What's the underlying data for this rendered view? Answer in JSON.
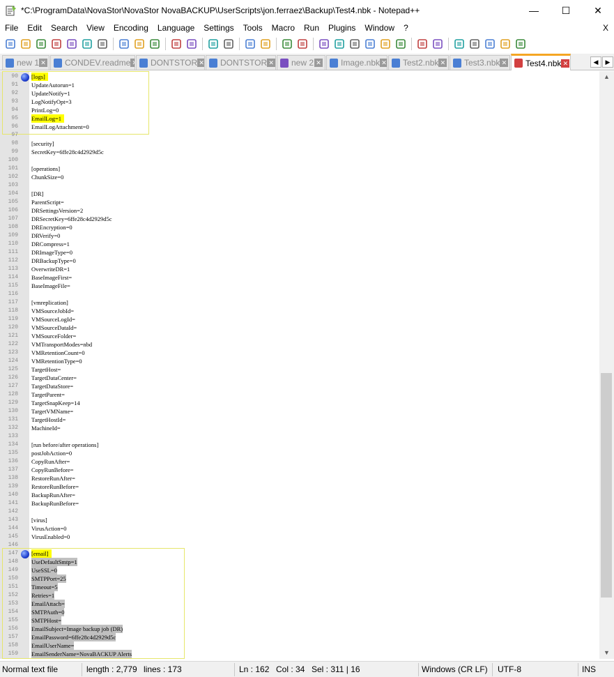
{
  "window": {
    "title": "*C:\\ProgramData\\NovaStor\\NovaStor NovaBACKUP\\UserScripts\\jon.ferraez\\Backup\\Test4.nbk - Notepad++",
    "minimize": "—",
    "maximize": "☐",
    "close": "✕"
  },
  "menu": {
    "items": [
      "File",
      "Edit",
      "Search",
      "View",
      "Encoding",
      "Language",
      "Settings",
      "Tools",
      "Macro",
      "Run",
      "Plugins",
      "Window",
      "?"
    ],
    "close": "X"
  },
  "toolbar": {
    "icons": [
      "new-file-icon",
      "open-file-icon",
      "save-icon",
      "save-all-icon",
      "close-icon",
      "close-all-icon",
      "print-icon",
      "cut-icon",
      "copy-icon",
      "paste-icon",
      "undo-icon",
      "redo-icon",
      "find-icon",
      "replace-icon",
      "zoom-in-icon",
      "zoom-out-icon",
      "sync-vertical-icon",
      "sync-horizontal-icon",
      "word-wrap-icon",
      "show-all-chars-icon",
      "indent-guide-icon",
      "doc-map-icon",
      "function-list-icon",
      "user-lang-icon",
      "folder-workspace-icon",
      "monitor-icon",
      "record-macro-icon",
      "stop-macro-icon",
      "play-macro-icon",
      "play-multiple-icon",
      "save-macro-icon"
    ]
  },
  "tabs": [
    {
      "label": "new 1",
      "active": false,
      "icon_color": "#4a7fd4"
    },
    {
      "label": "CONDEV.readme",
      "active": false,
      "icon_color": "#4a7fd4"
    },
    {
      "label": "DONTSTOR",
      "active": false,
      "icon_color": "#4a7fd4"
    },
    {
      "label": "DONTSTOR",
      "active": false,
      "icon_color": "#4a7fd4"
    },
    {
      "label": "new 2",
      "active": false,
      "icon_color": "#7a4fc0"
    },
    {
      "label": "Image.nbk",
      "active": false,
      "icon_color": "#4a7fd4"
    },
    {
      "label": "Test2.nbk",
      "active": false,
      "icon_color": "#4a7fd4"
    },
    {
      "label": "Test3.nbk",
      "active": false,
      "icon_color": "#4a7fd4"
    },
    {
      "label": "Test4.nbk",
      "active": true,
      "icon_color": "#d24040"
    }
  ],
  "lines": [
    {
      "n": "90",
      "text": "[logs]",
      "hl": "yellow",
      "bookmark": true
    },
    {
      "n": "91",
      "text": "UpdateAutorun=1"
    },
    {
      "n": "92",
      "text": "UpdateNotify=1"
    },
    {
      "n": "93",
      "text": "LogNotifyOpt=3"
    },
    {
      "n": "94",
      "text": "PrintLog=0"
    },
    {
      "n": "95",
      "text": "EmailLog=1",
      "hl": "yellow"
    },
    {
      "n": "96",
      "text": "EmailLogAttachment=0"
    },
    {
      "n": "97",
      "text": ""
    },
    {
      "n": "98",
      "text": "[security]"
    },
    {
      "n": "99",
      "text": "SecretKey=6ffe28c4d2929d5c"
    },
    {
      "n": "100",
      "text": ""
    },
    {
      "n": "101",
      "text": "[operations]"
    },
    {
      "n": "102",
      "text": "ChunkSize=0"
    },
    {
      "n": "103",
      "text": ""
    },
    {
      "n": "104",
      "text": "[DR]"
    },
    {
      "n": "105",
      "text": "ParentScript="
    },
    {
      "n": "106",
      "text": "DRSettingsVersion=2"
    },
    {
      "n": "107",
      "text": "DRSecretKey=6ffe28c4d2929d5c"
    },
    {
      "n": "108",
      "text": "DREncryption=0"
    },
    {
      "n": "109",
      "text": "DRVerify=0"
    },
    {
      "n": "110",
      "text": "DRCompress=1"
    },
    {
      "n": "111",
      "text": "DRImageType=0"
    },
    {
      "n": "112",
      "text": "DRBackupType=0"
    },
    {
      "n": "113",
      "text": "OverwriteDR=1"
    },
    {
      "n": "114",
      "text": "BaseImageFirst="
    },
    {
      "n": "115",
      "text": "BaseImageFile="
    },
    {
      "n": "116",
      "text": ""
    },
    {
      "n": "117",
      "text": "[vmreplication]"
    },
    {
      "n": "118",
      "text": "VMSourceJobId="
    },
    {
      "n": "119",
      "text": "VMSourceLogId="
    },
    {
      "n": "120",
      "text": "VMSourceDataId="
    },
    {
      "n": "121",
      "text": "VMSourceFolder="
    },
    {
      "n": "122",
      "text": "VMTransportModes=nbd"
    },
    {
      "n": "123",
      "text": "VMRetentionCount=0"
    },
    {
      "n": "124",
      "text": "VMRetentionType=0"
    },
    {
      "n": "125",
      "text": "TargetHost="
    },
    {
      "n": "126",
      "text": "TargetDataCenter="
    },
    {
      "n": "127",
      "text": "TargetDataStore="
    },
    {
      "n": "128",
      "text": "TargetParent="
    },
    {
      "n": "129",
      "text": "TargetSnapKeep=14"
    },
    {
      "n": "130",
      "text": "TargetVMName="
    },
    {
      "n": "131",
      "text": "TargetHostId="
    },
    {
      "n": "132",
      "text": "MachineId="
    },
    {
      "n": "133",
      "text": ""
    },
    {
      "n": "134",
      "text": "[run before/after operations]"
    },
    {
      "n": "135",
      "text": "postJobAction=0"
    },
    {
      "n": "136",
      "text": "CopyRunAfter="
    },
    {
      "n": "137",
      "text": "CopyRunBefore="
    },
    {
      "n": "138",
      "text": "RestoreRunAfter="
    },
    {
      "n": "139",
      "text": "RestoreRunBefore="
    },
    {
      "n": "140",
      "text": "BackupRunAfter="
    },
    {
      "n": "141",
      "text": "BackupRunBefore="
    },
    {
      "n": "142",
      "text": ""
    },
    {
      "n": "143",
      "text": "[virus]"
    },
    {
      "n": "144",
      "text": "VirusAction=0"
    },
    {
      "n": "145",
      "text": "VirusEnabled=0"
    },
    {
      "n": "146",
      "text": ""
    },
    {
      "n": "147",
      "text": "[email]",
      "hl": "yellow",
      "bookmark": true
    },
    {
      "n": "148",
      "text": "UseDefaultSmtp=1",
      "hl": "gray"
    },
    {
      "n": "149",
      "text": "UseSSL=0",
      "hl": "gray"
    },
    {
      "n": "150",
      "text": "SMTPPort=25",
      "hl": "gray"
    },
    {
      "n": "151",
      "text": "Timeout=5",
      "hl": "gray"
    },
    {
      "n": "152",
      "text": "Retries=1",
      "hl": "gray"
    },
    {
      "n": "153",
      "text": "EmailAttach=",
      "hl": "gray"
    },
    {
      "n": "154",
      "text": "SMTPAuth=0",
      "hl": "gray"
    },
    {
      "n": "155",
      "text": "SMTPHost=",
      "hl": "gray"
    },
    {
      "n": "156",
      "text": "EmailSubject=Image backup job (DR)",
      "hl": "gray"
    },
    {
      "n": "157",
      "text": "EmailPassword=6ffe28c4d2929d5c",
      "hl": "gray"
    },
    {
      "n": "158",
      "text": "EmailUserName=",
      "hl": "gray"
    },
    {
      "n": "159",
      "text": "EmailSenderName=NovaBACKUP Alerts",
      "hl": "gray"
    }
  ],
  "status": {
    "type": "Normal text file",
    "length": "length : 2,779",
    "lines": "lines : 173",
    "ln": "Ln : 162",
    "col": "Col : 34",
    "sel": "Sel : 311 | 16",
    "eol": "Windows (CR LF)",
    "encoding": "UTF-8",
    "mode": "INS"
  },
  "colors": {
    "highlight_yellow": "#ffff00",
    "highlight_gray": "#c0c0c0",
    "active_tab_accent": "#f5a623",
    "bookmark": "#2040d0"
  }
}
